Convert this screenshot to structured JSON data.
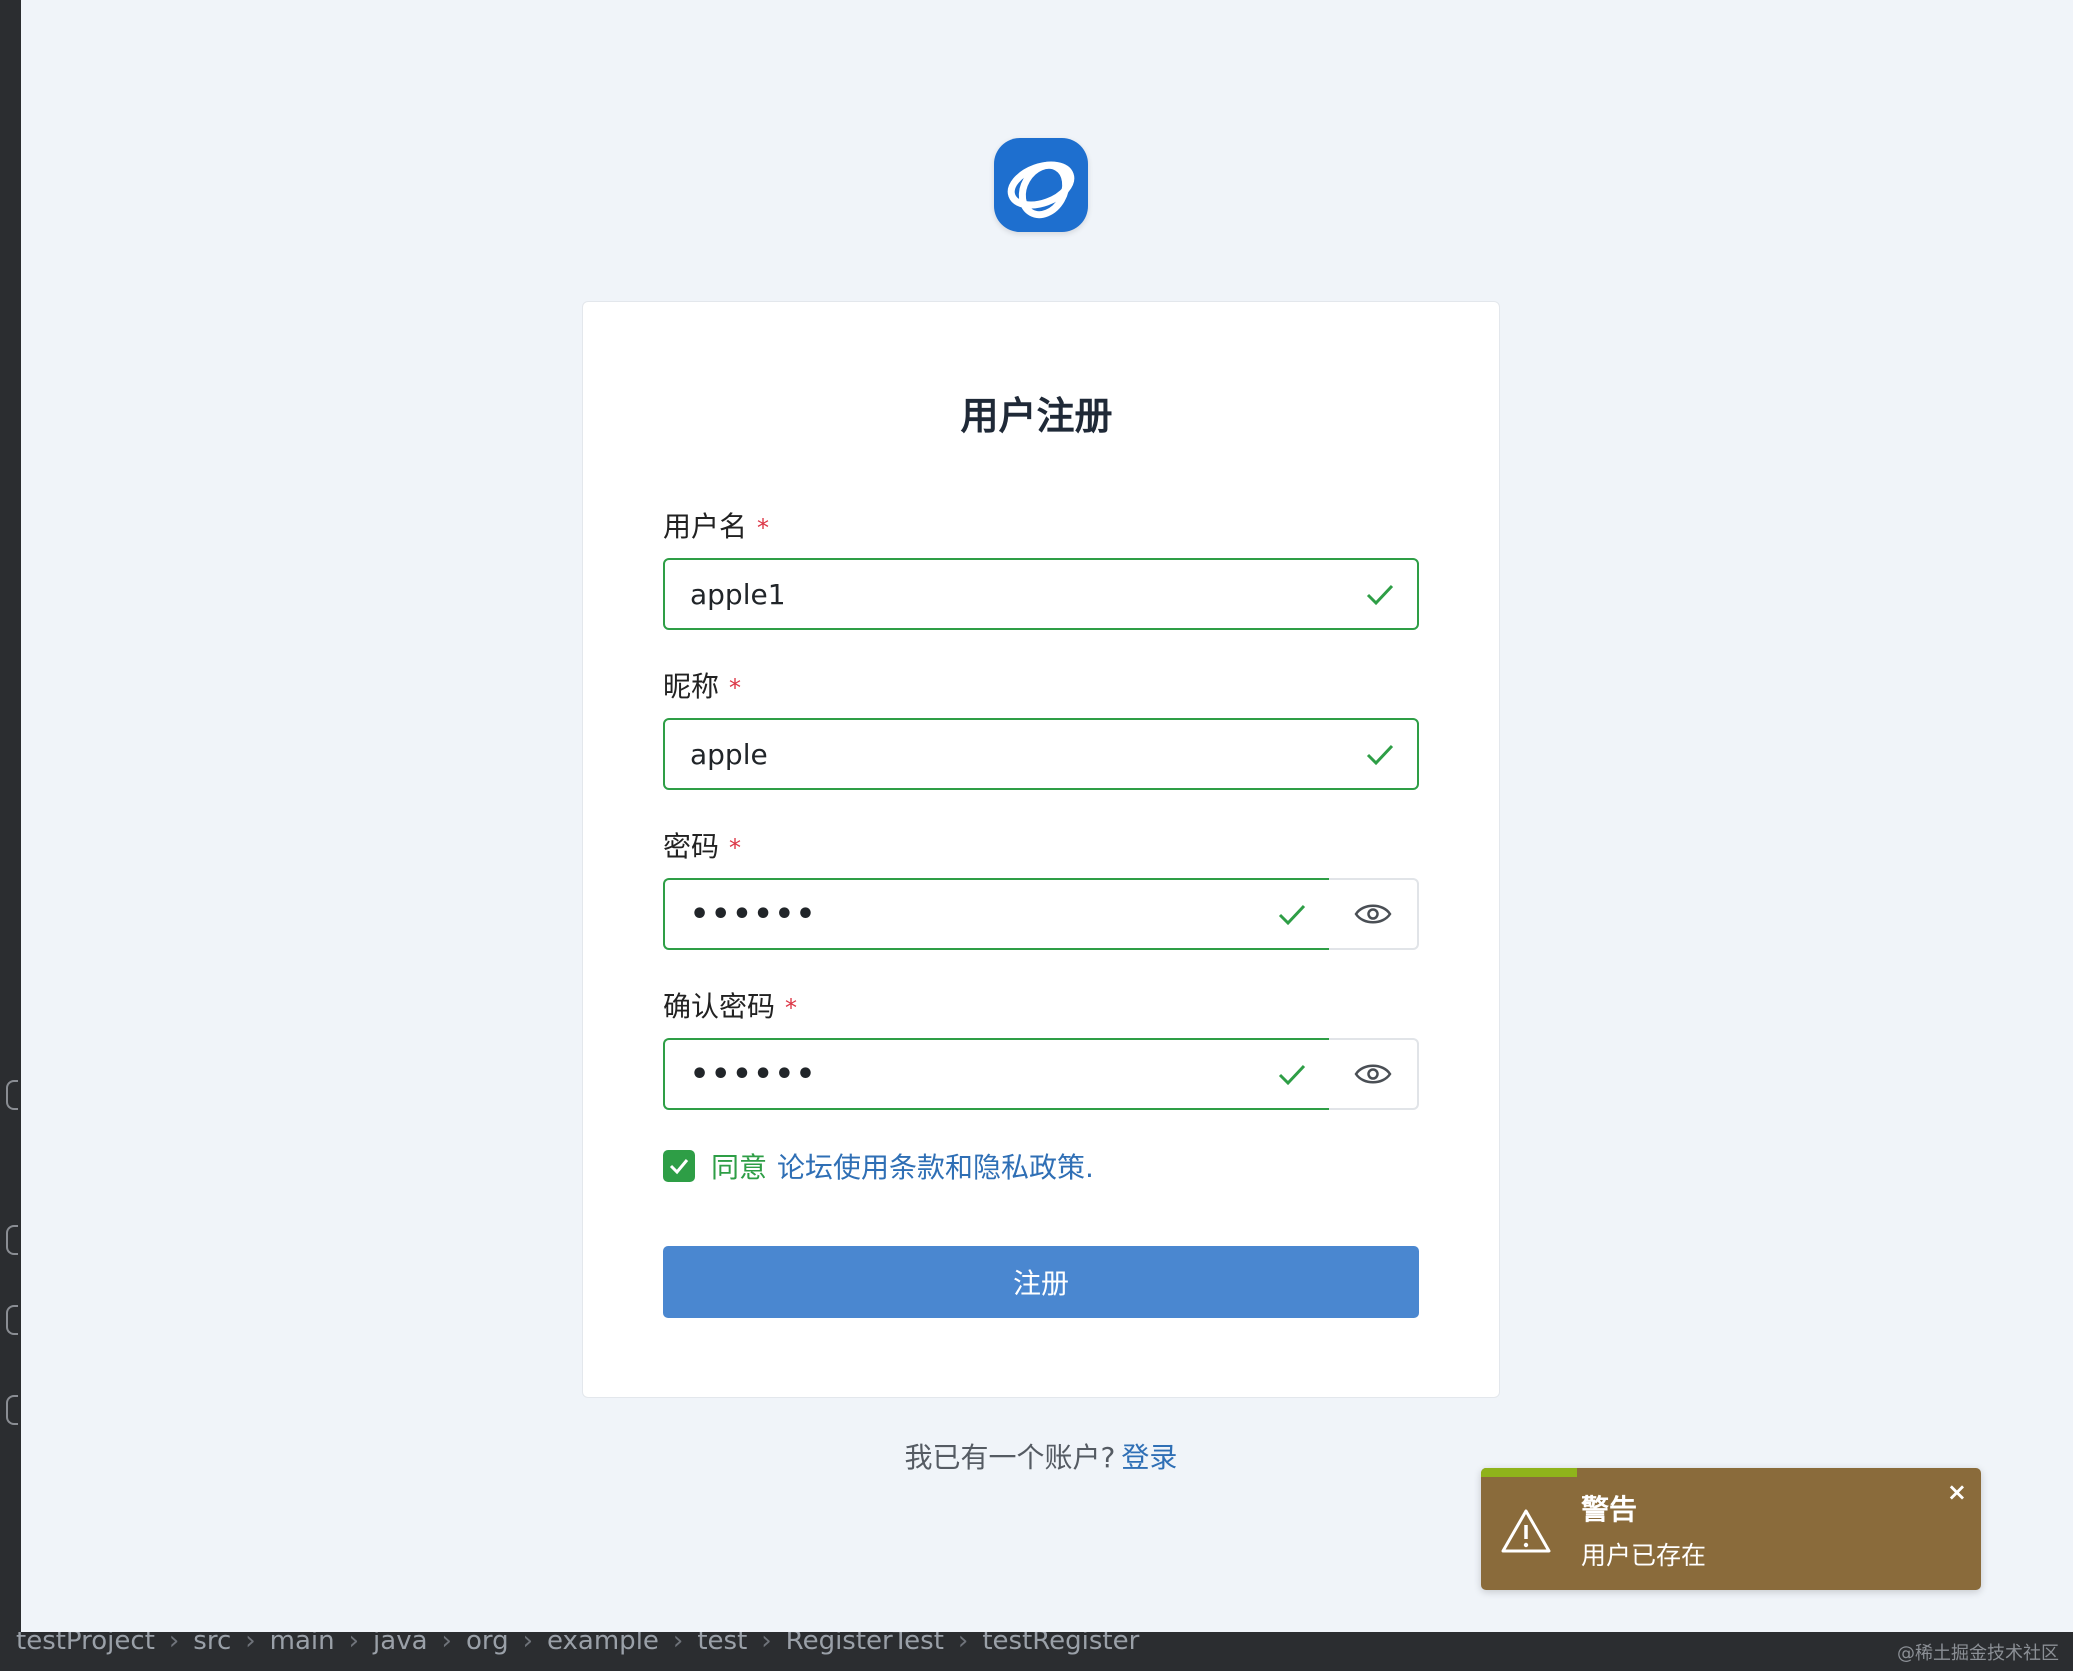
{
  "ide": {
    "breadcrumbs": [
      "testProject",
      "src",
      "main",
      "java",
      "org",
      "example",
      "test",
      "RegisterTest",
      "testRegister"
    ],
    "watermark": "@稀土掘金技术社区"
  },
  "brand": {
    "logo_icon": "orbit-logo-icon",
    "color": "#1e6fcf"
  },
  "form": {
    "title": "用户注册",
    "username": {
      "label": "用户名",
      "required_mark": "*",
      "value": "apple1"
    },
    "nickname": {
      "label": "昵称",
      "required_mark": "*",
      "value": "apple"
    },
    "password": {
      "label": "密码",
      "required_mark": "*",
      "value": "••••••"
    },
    "confirm_password": {
      "label": "确认密码",
      "required_mark": "*",
      "value": "••••••"
    },
    "agree": {
      "checked": true,
      "text": "同意",
      "link_text": "论坛使用条款和隐私政策."
    },
    "submit_label": "注册",
    "valid_color": "#2e9e46"
  },
  "footer": {
    "prompt": "我已有一个账户?",
    "login_link": "登录"
  },
  "toast": {
    "title": "警告",
    "message": "用户已存在",
    "close": "×",
    "bg": "#8a6b3b"
  }
}
